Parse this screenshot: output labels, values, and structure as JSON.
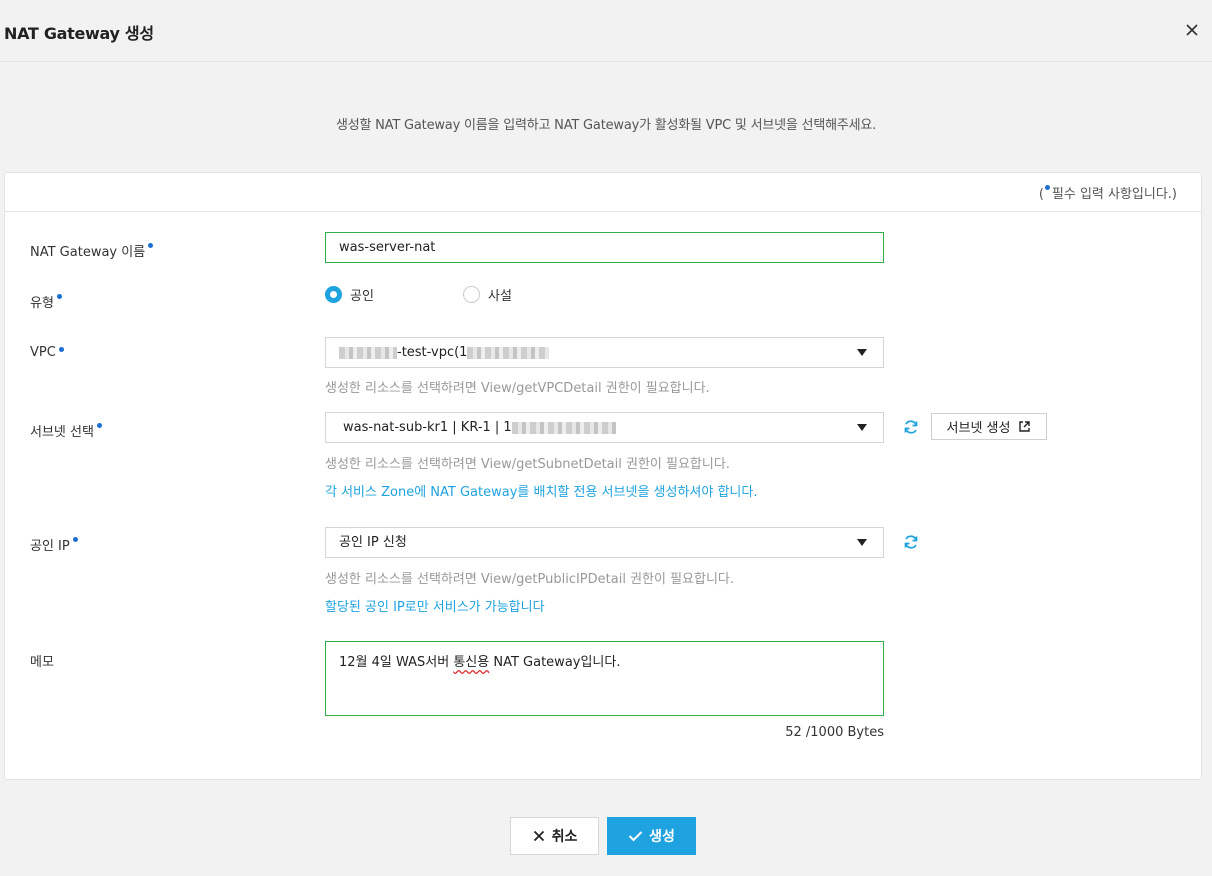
{
  "dialog": {
    "title": "NAT Gateway 생성",
    "subtitle": "생성할 NAT Gateway 이름을 입력하고 NAT Gateway가 활성화될 VPC 및 서브넷을 선택해주세요.",
    "required_note_prefix": "(",
    "required_note_text": "필수 입력 사항입니다.)"
  },
  "form": {
    "name": {
      "label": "NAT Gateway 이름",
      "value": "was-server-nat"
    },
    "type": {
      "label": "유형",
      "options": [
        {
          "label": "공인",
          "selected": true
        },
        {
          "label": "사설",
          "selected": false
        }
      ]
    },
    "vpc": {
      "label": "VPC",
      "value_suffix": "-test-vpc(1",
      "help": "생성한 리소스를 선택하려면 View/getVPCDetail 권한이 필요합니다."
    },
    "subnet": {
      "label": "서브넷 선택",
      "value_prefix": "was-nat-sub-kr1 | KR-1 | 1",
      "help": "생성한 리소스를 선택하려면 View/getSubnetDetail 권한이 필요합니다.",
      "notice": "각 서비스 Zone에 NAT Gateway를 배치할 전용 서브넷을 생성하셔야 합니다.",
      "create_button": "서브넷 생성"
    },
    "public_ip": {
      "label": "공인 IP",
      "value": "공인 IP 신청",
      "help": "생성한 리소스를 선택하려면 View/getPublicIPDetail 권한이 필요합니다.",
      "notice": "할당된 공인 IP로만 서비스가 가능합니다"
    },
    "memo": {
      "label": "메모",
      "value_before": "12월 4일 WAS서버 ",
      "value_marked": "통신용",
      "value_after": " NAT Gateway입니다.",
      "counter": "52 /1000 Bytes"
    }
  },
  "footer": {
    "cancel_label": "취소",
    "create_label": "생성"
  },
  "colors": {
    "accent": "#1fa3e0",
    "required_dot": "#1a6fd0",
    "valid_border": "#2db24a"
  }
}
